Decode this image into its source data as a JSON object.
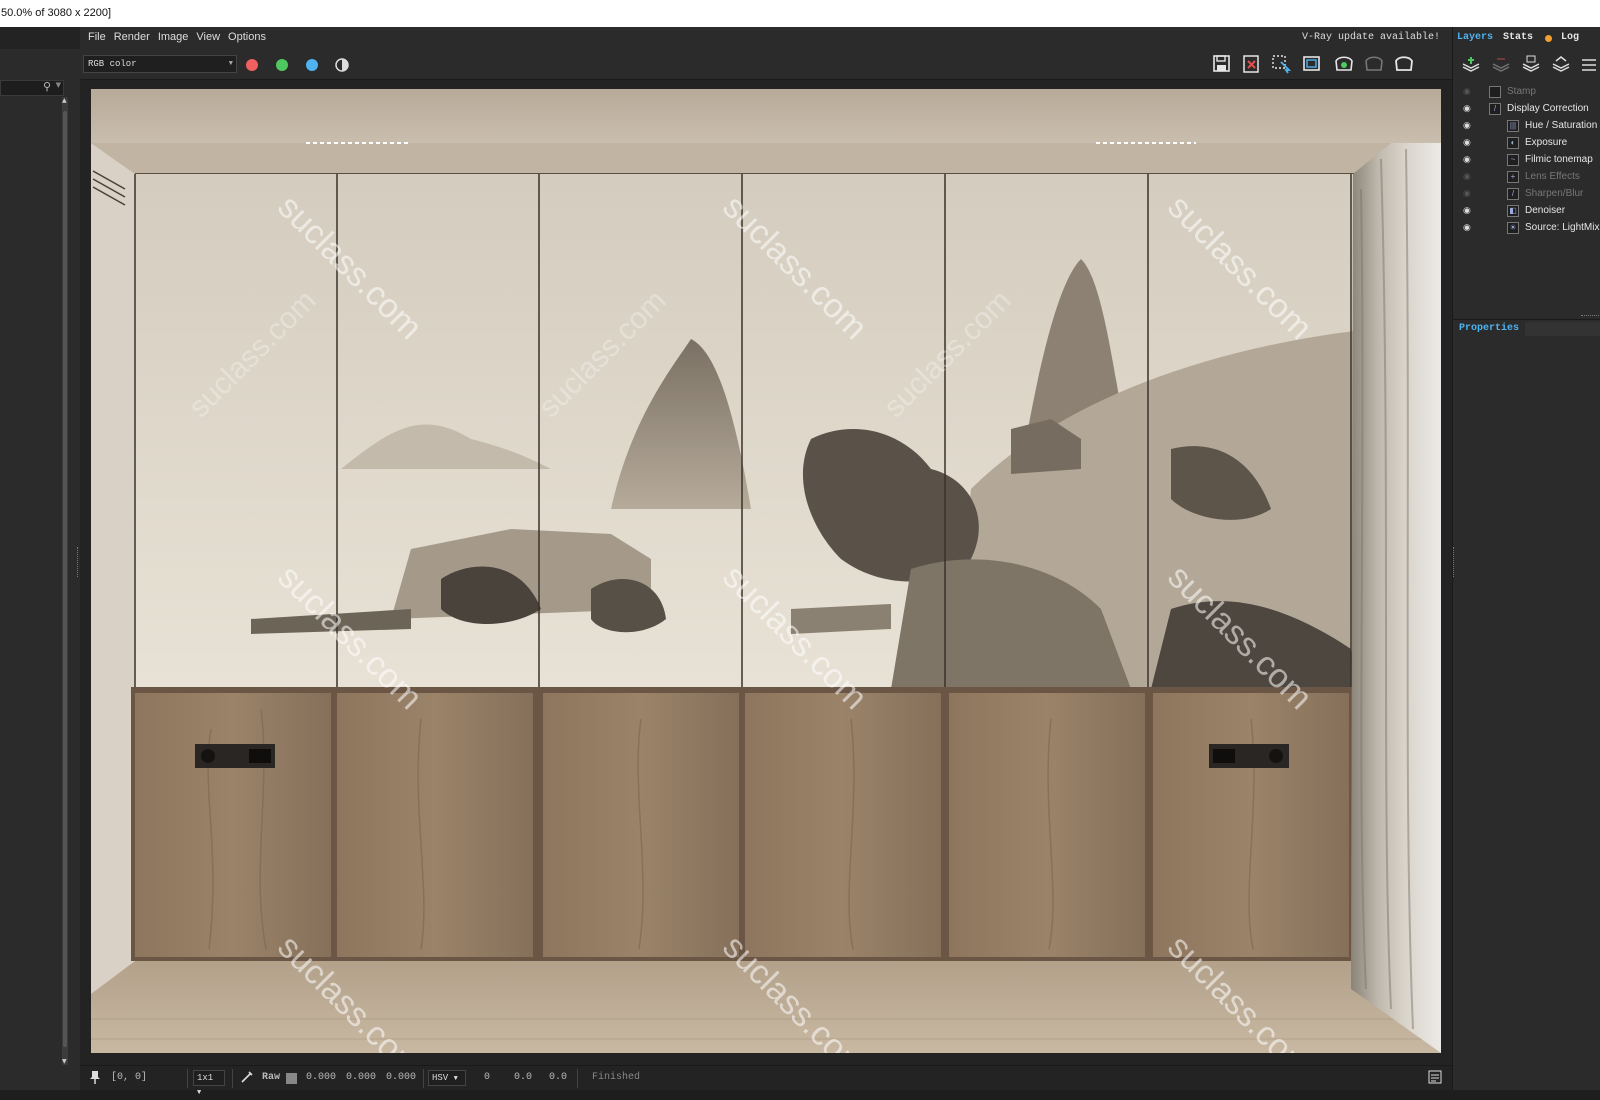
{
  "window": {
    "title": "50.0% of 3080 x 2200]"
  },
  "menu": {
    "items": [
      "File",
      "Render",
      "Image",
      "View",
      "Options"
    ],
    "notice": "V-Ray update available!"
  },
  "toolbar": {
    "channel": "RGB color",
    "colors": {
      "red": "#f06060",
      "green": "#4fc860",
      "blue": "#4fb3f0"
    }
  },
  "viewport": {
    "watermark": "suclass.com"
  },
  "status": {
    "coords": "[0, 0]",
    "zoom": "1x1",
    "raw_label": "Raw",
    "raw_values": [
      "0.000",
      "0.000",
      "0.000"
    ],
    "color_mode": "HSV",
    "hsv_values": [
      "0",
      "0.0",
      "0.0"
    ],
    "state": "Finished"
  },
  "right": {
    "tabs": {
      "layers": "Layers",
      "stats": "Stats",
      "log": "Log"
    },
    "layers": [
      {
        "name": "Stamp",
        "dim": true,
        "indent": 0,
        "icon": "stamp-icon"
      },
      {
        "name": "Display Correction",
        "dim": false,
        "indent": 0,
        "icon": "curve-icon"
      },
      {
        "name": "Hue / Saturation",
        "dim": false,
        "indent": 1,
        "icon": "hue-icon"
      },
      {
        "name": "Exposure",
        "dim": false,
        "indent": 1,
        "icon": "exposure-icon"
      },
      {
        "name": "Filmic tonemap",
        "dim": false,
        "indent": 1,
        "icon": "tonemap-icon"
      },
      {
        "name": "Lens Effects",
        "dim": true,
        "indent": 1,
        "icon": "lens-icon"
      },
      {
        "name": "Sharpen/Blur",
        "dim": true,
        "indent": 1,
        "icon": "sharpen-icon"
      },
      {
        "name": "Denoiser",
        "dim": false,
        "indent": 1,
        "icon": "denoiser-icon"
      },
      {
        "name": "Source: LightMix",
        "dim": false,
        "indent": 1,
        "icon": "source-icon"
      }
    ],
    "properties": "Properties",
    "accent": "#4fb3f0",
    "log_dot": "#f0a030"
  }
}
